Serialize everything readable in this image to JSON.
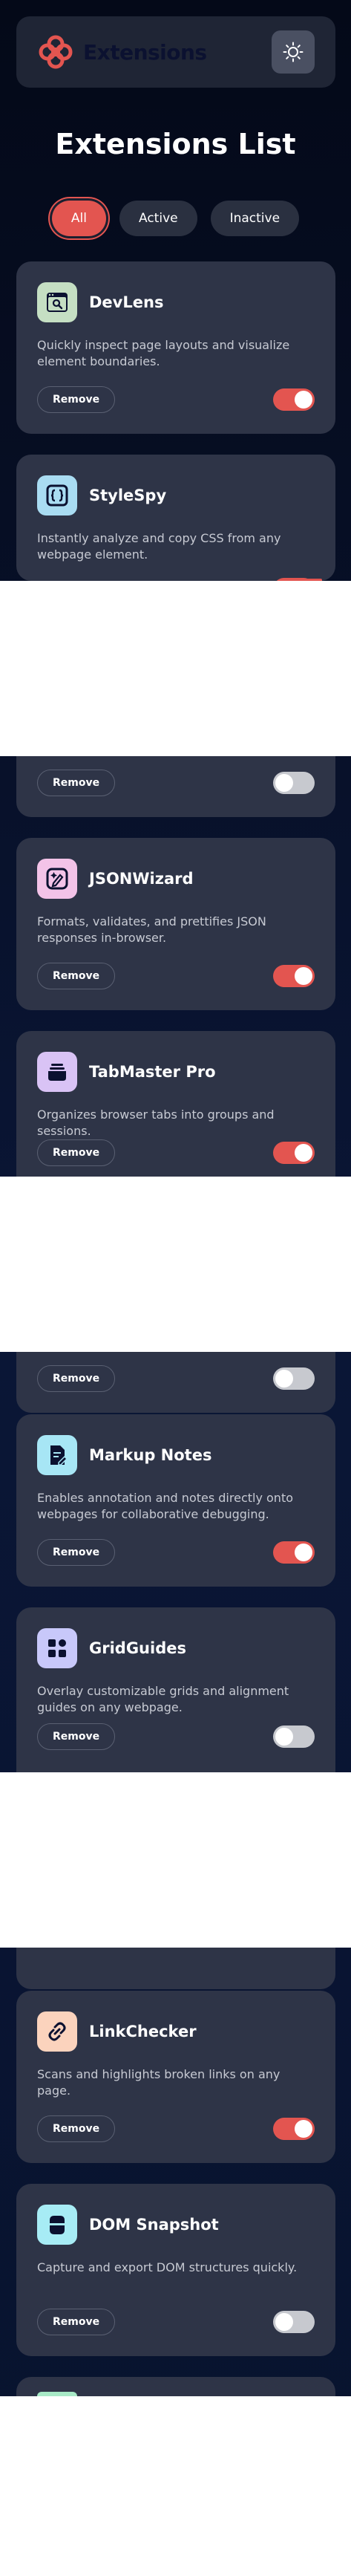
{
  "header": {
    "logo_text": "Extensions",
    "theme_icon": "sun-icon"
  },
  "page_title": "Extensions List",
  "filters": [
    {
      "label": "All",
      "active": true
    },
    {
      "label": "Active",
      "active": false
    },
    {
      "label": "Inactive",
      "active": false
    }
  ],
  "remove_label": "Remove",
  "extensions": [
    {
      "name": "DevLens",
      "description": "Quickly inspect page layouts and visualize element boundaries.",
      "active": true,
      "icon": "devlens-icon",
      "icon_bg": "#c5dfc3"
    },
    {
      "name": "StyleSpy",
      "description": "Instantly analyze and copy CSS from any webpage element.",
      "active": true,
      "icon": "stylespy-icon",
      "icon_bg": "#a9dcf2"
    },
    {
      "name": "",
      "description": "",
      "active": false,
      "icon": "",
      "icon_bg": ""
    },
    {
      "name": "JSONWizard",
      "description": "Formats, validates, and prettifies JSON responses in-browser.",
      "active": true,
      "icon": "jsonwizard-icon",
      "icon_bg": "#f3c3e8"
    },
    {
      "name": "TabMaster Pro",
      "description": "Organizes browser tabs into groups and sessions.",
      "active": true,
      "icon": "tabmaster-icon",
      "icon_bg": "#d9c3f5"
    },
    {
      "name": "",
      "description": "",
      "active": false,
      "icon": "",
      "icon_bg": ""
    },
    {
      "name": "Markup Notes",
      "description": "Enables annotation and notes directly onto webpages for collaborative debugging.",
      "active": true,
      "icon": "markup-notes-icon",
      "icon_bg": "#a7e6f5"
    },
    {
      "name": "GridGuides",
      "description": "Overlay customizable grids and alignment guides on any webpage.",
      "active": false,
      "icon": "gridguides-icon",
      "icon_bg": "#c8c8fa"
    },
    {
      "name": "",
      "description": "",
      "active": false,
      "icon": "",
      "icon_bg": ""
    },
    {
      "name": "LinkChecker",
      "description": "Scans and highlights broken links on any page.",
      "active": true,
      "icon": "linkchecker-icon",
      "icon_bg": "#fbd3bd"
    },
    {
      "name": "DOM Snapshot",
      "description": "Capture and export DOM structures quickly.",
      "active": false,
      "icon": "dom-snapshot-icon",
      "icon_bg": "#a7ecf5"
    },
    {
      "name": "",
      "description": "",
      "active": false,
      "icon": "",
      "icon_bg": "#a8e9c6"
    }
  ],
  "colors": {
    "accent": "#e35550",
    "card_bg": "#2e3447",
    "page_bg": "#040918"
  }
}
